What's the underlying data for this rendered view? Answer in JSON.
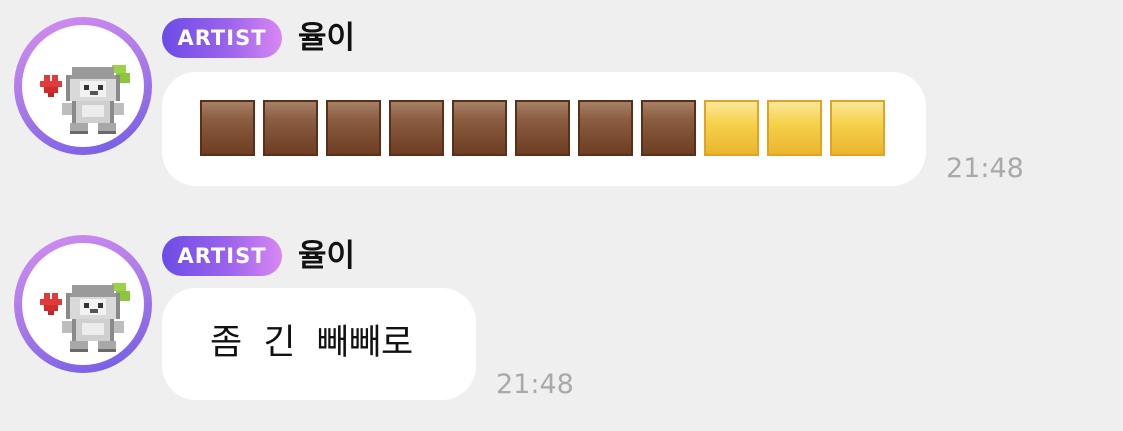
{
  "messages": [
    {
      "badge": "ARTIST",
      "sender": "율이",
      "content": {
        "type": "emoji-blocks",
        "blocks": [
          "brown-square",
          "brown-square",
          "brown-square",
          "brown-square",
          "brown-square",
          "brown-square",
          "brown-square",
          "brown-square",
          "yellow-square",
          "yellow-square",
          "yellow-square"
        ]
      },
      "time": "21:48"
    },
    {
      "badge": "ARTIST",
      "sender": "율이",
      "content": {
        "type": "text",
        "text": "좀 긴 빼빼로"
      },
      "time": "21:48"
    }
  ],
  "colors": {
    "badge_gradient": [
      "#6c4ce6",
      "#d888f2"
    ],
    "avatar_ring": [
      "#d58ef0",
      "#6f5ae6"
    ],
    "brown_block": "#6e3d22",
    "yellow_block": "#f6d24c",
    "time_text": "#a9a9a9"
  }
}
